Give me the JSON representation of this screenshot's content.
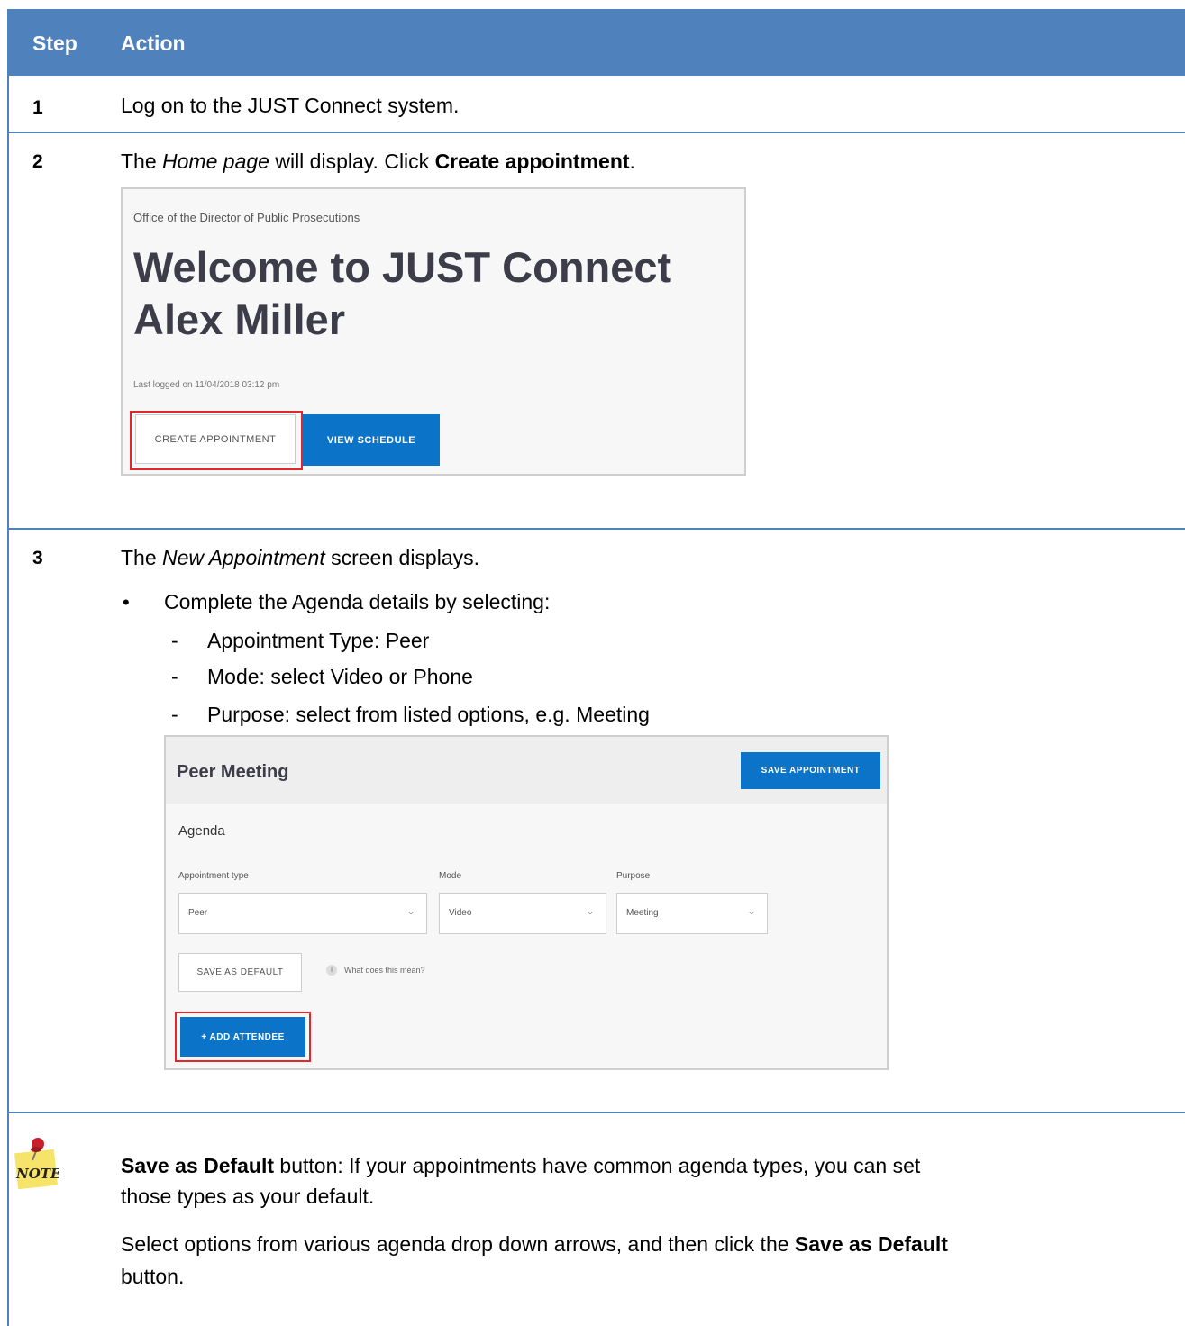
{
  "header": {
    "step_label": "Step",
    "action_label": "Action"
  },
  "steps": [
    {
      "num": "1",
      "text": "Log on to the JUST Connect system."
    },
    {
      "num": "2",
      "text_pre": "The ",
      "text_page": "Home page",
      "text_mid": " will display. Click ",
      "text_button": "Create appointment",
      "text_end": "."
    },
    {
      "num": "3",
      "text_pre": "The ",
      "text_screen": "New Appointment",
      "text_end": " screen displays."
    }
  ],
  "welcome_screen": {
    "org": "Office of the Director of Public Prosecutions",
    "welcome_line1": "Welcome to JUST Connect",
    "welcome_line2": "Alex Miller",
    "last_logged": "Last logged on 11/04/2018 03:12 pm",
    "create_appointment": "CREATE APPOINTMENT",
    "view_schedule": "VIEW SCHEDULE"
  },
  "agenda_instructions": {
    "bullet": "Complete the Agenda details by selecting:",
    "items": [
      "Appointment Type:  Peer",
      "Mode: select Video or Phone",
      "Purpose: select from listed options, e.g. Meeting"
    ]
  },
  "appointment_screen": {
    "title": "Peer Meeting",
    "save_appointment": "SAVE APPOINTMENT",
    "agenda_heading": "Agenda",
    "fields": [
      {
        "label": "Appointment type",
        "value": "Peer"
      },
      {
        "label": "Mode",
        "value": "Video"
      },
      {
        "label": "Purpose",
        "value": "Meeting"
      }
    ],
    "save_as_default": "SAVE AS DEFAULT",
    "what_does_this_mean": "What does this mean?",
    "add_attendee": "+ ADD ATTENDEE"
  },
  "note": {
    "icon_label": "NOTE",
    "p1_bold": "Save as Default",
    "p1_line1_rest": " button: If your appointments have common agenda types, you can set",
    "p1_line2": "those types as your default.",
    "p2_line1_pre": "Select options from various agenda drop down arrows, and then click the ",
    "p2_line1_bold": "Save as Default",
    "p2_line2": "button."
  }
}
